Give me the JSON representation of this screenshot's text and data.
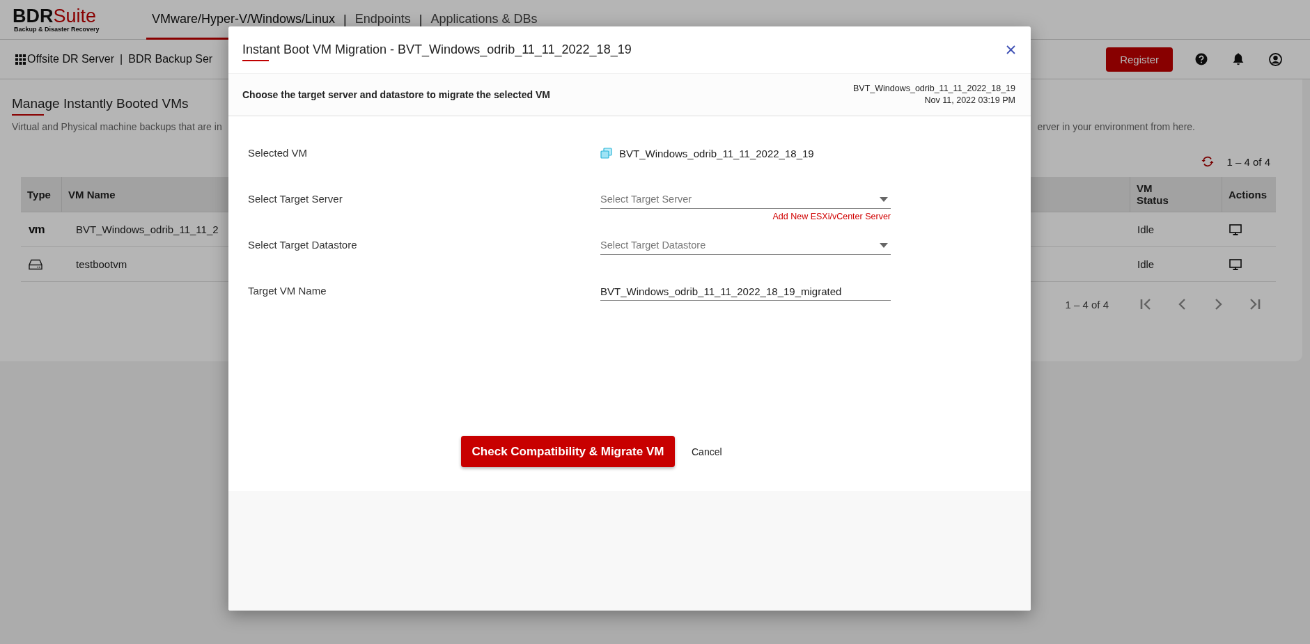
{
  "header": {
    "logo": {
      "brand_dark": "BDR",
      "brand_accent": "Suite",
      "tagline": "Backup & Disaster Recovery"
    },
    "tabs": [
      {
        "kind": "tab",
        "label": "VMware/Hyper-V/Windows/Linux",
        "selected": true
      },
      {
        "kind": "separator",
        "label": "|"
      },
      {
        "kind": "tab",
        "label": "Endpoints",
        "selected": false
      },
      {
        "kind": "separator",
        "label": "|"
      },
      {
        "kind": "tab",
        "label": "Applications & DBs",
        "selected": false
      }
    ]
  },
  "toolbar": {
    "breadcrumb": [
      {
        "kind": "link",
        "label": "Offsite DR Server"
      },
      {
        "kind": "separator",
        "label": "|"
      },
      {
        "kind": "link",
        "label": "BDR Backup Ser"
      }
    ],
    "register": "Register"
  },
  "page": {
    "title": "Manage Instantly Booted VMs",
    "description_start": "Virtual and Physical machine backups that are in",
    "description_end": "erver in your environment from here.",
    "count": "1 – 4 of 4",
    "table": {
      "columns": [
        "Type",
        "VM Name",
        "VM Status",
        "Actions"
      ],
      "rows": [
        {
          "kind": "vmware",
          "type_text": "vm",
          "name": "BVT_Windows_odrib_11_11_2",
          "status": "Idle"
        },
        {
          "kind": "disk",
          "name": "testbootvm",
          "status": "Idle"
        }
      ]
    },
    "pagination": {
      "range": "1 – 4 of 4",
      "nav": [
        {
          "kind": "first",
          "disabled": true
        },
        {
          "kind": "prev",
          "disabled": true
        },
        {
          "kind": "next",
          "disabled": true
        },
        {
          "kind": "last",
          "disabled": true
        }
      ]
    }
  },
  "dialog": {
    "title": "Instant Boot VM Migration - BVT_Windows_odrib_11_11_2022_18_19",
    "subtitle": "Choose the target server and datastore to migrate the selected VM",
    "meta_name": "BVT_Windows_odrib_11_11_2022_18_19",
    "meta_date": "Nov 11, 2022 03:19 PM",
    "fields": [
      {
        "kind": "static",
        "label": "Selected VM",
        "value": "BVT_Windows_odrib_11_11_2022_18_19"
      },
      {
        "kind": "select",
        "label": "Select Target Server",
        "placeholder": "Select Target Server",
        "link": "Add New ESXi/vCenter Server"
      },
      {
        "kind": "select",
        "label": "Select Target Datastore",
        "placeholder": "Select Target Datastore"
      },
      {
        "kind": "input",
        "label": "Target VM Name",
        "value": "BVT_Windows_odrib_11_11_2022_18_19_migrated"
      }
    ],
    "primary": "Check Compatibility & Migrate VM",
    "cancel": "Cancel"
  }
}
